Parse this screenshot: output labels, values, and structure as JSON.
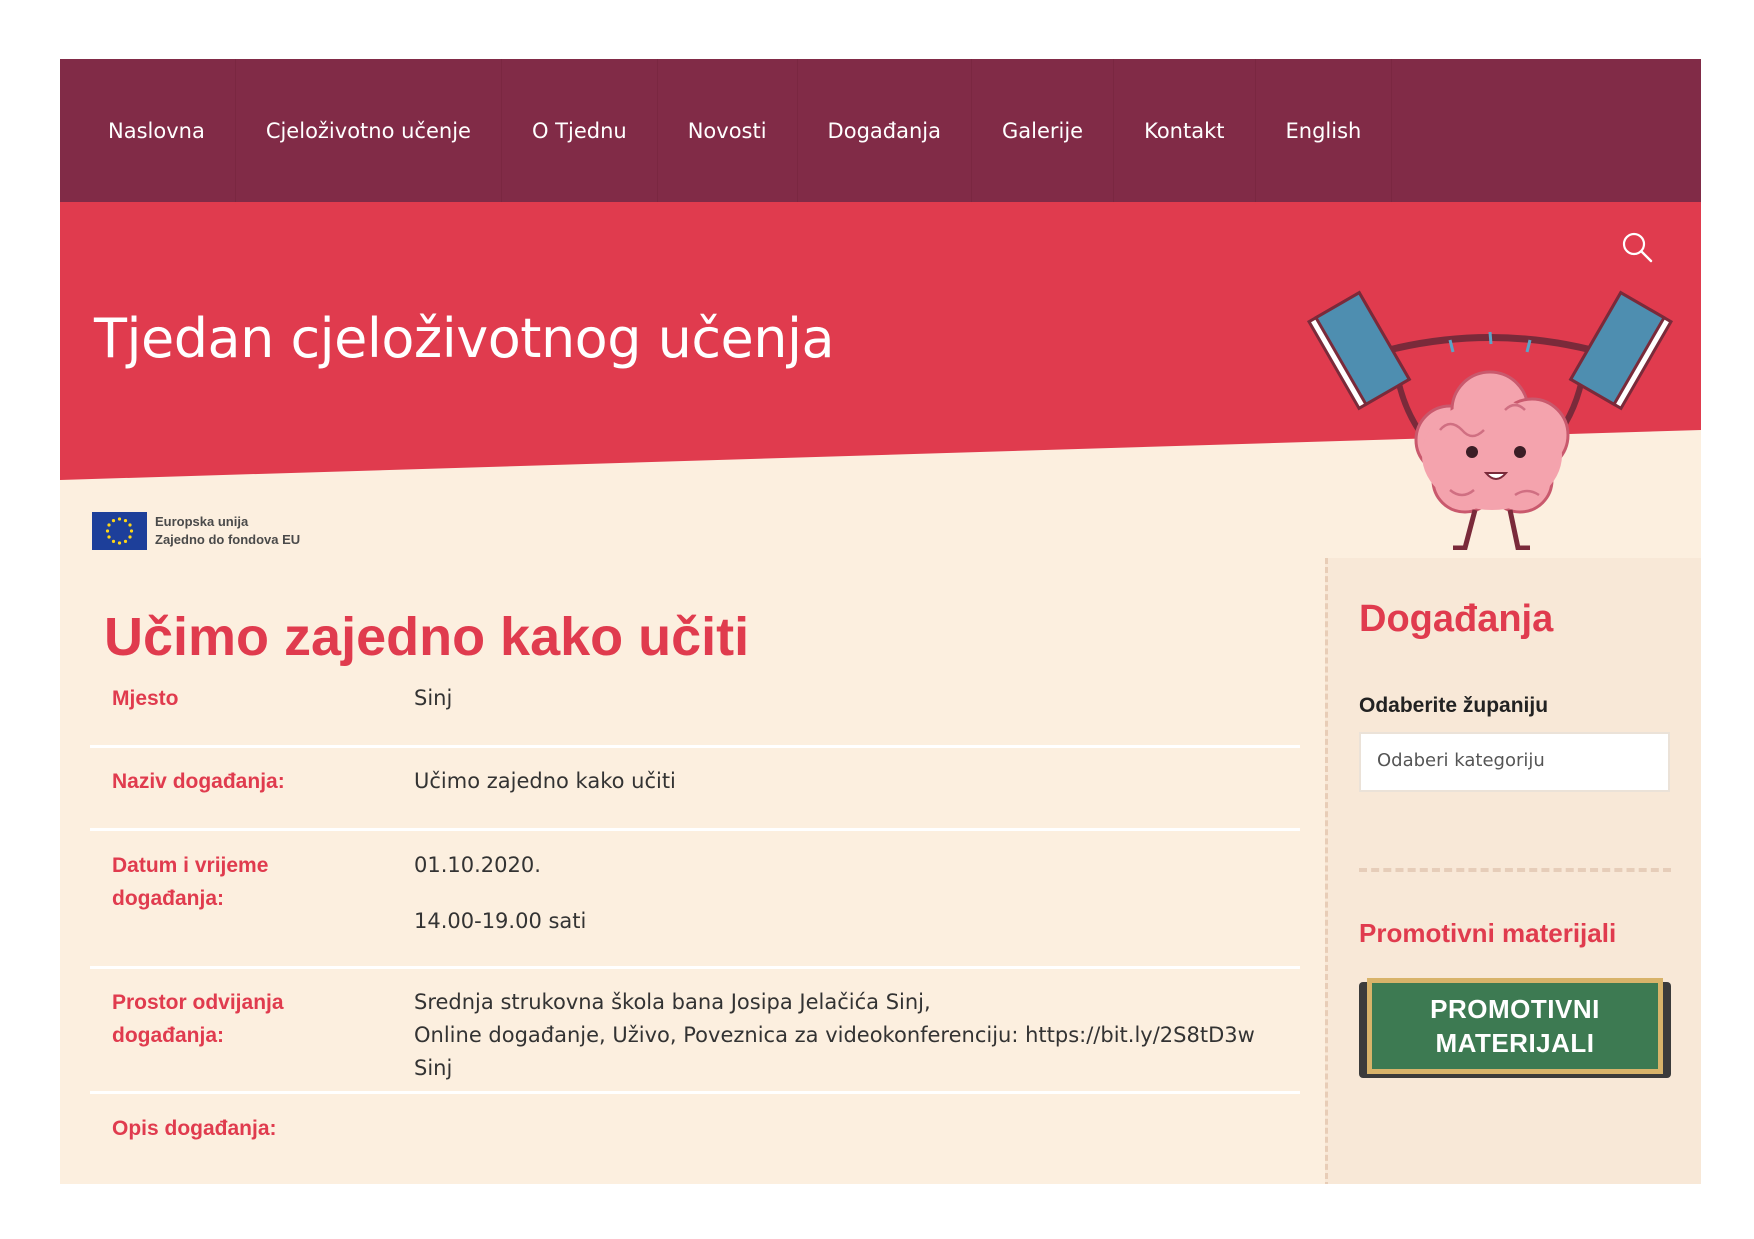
{
  "nav": {
    "items": [
      {
        "label": "Naslovna"
      },
      {
        "label": "Cjeloživotno učenje"
      },
      {
        "label": "O Tjednu"
      },
      {
        "label": "Novosti"
      },
      {
        "label": "Događanja"
      },
      {
        "label": "Galerije"
      },
      {
        "label": "Kontakt"
      },
      {
        "label": "English"
      }
    ]
  },
  "header": {
    "site_title": "Tjedan cjeloživotnog učenja",
    "search_icon": "search-icon",
    "mascot_icon": "brain-lifting-books"
  },
  "eu": {
    "line1": "Europska unija",
    "line2": "Zajedno do fondova EU"
  },
  "event": {
    "title": "Učimo zajedno kako učiti",
    "rows": [
      {
        "label": "Mjesto",
        "value": "Sinj"
      },
      {
        "label": "Naziv događanja:",
        "value": "Učimo zajedno kako učiti"
      },
      {
        "label": "Datum i vrijeme događanja:",
        "date": "01.10.2020.",
        "time": "14.00-19.00 sati"
      },
      {
        "label": "Prostor odvijanja događanja:",
        "line1": "Srednja strukovna škola bana Josipa Jelačića Sinj,",
        "line2": "Online događanje, Uživo, Poveznica za videokonferenciju: https://bit.ly/2S8tD3w",
        "line3": "Sinj"
      },
      {
        "label": "Opis događanja:"
      }
    ]
  },
  "sidebar": {
    "heading": "Događanja",
    "select_label": "Odaberite županiju",
    "select_value": "Odaberi kategoriju",
    "promo_heading": "Promotivni materijali",
    "promo_line1": "PROMOTIVNI",
    "promo_line2": "MATERIJALI"
  },
  "colors": {
    "nav_bg": "#812b47",
    "hero_red": "#e03b4e",
    "cream": "#fcefdf",
    "accent": "#e03b4e",
    "board_green": "#3d7a52"
  }
}
